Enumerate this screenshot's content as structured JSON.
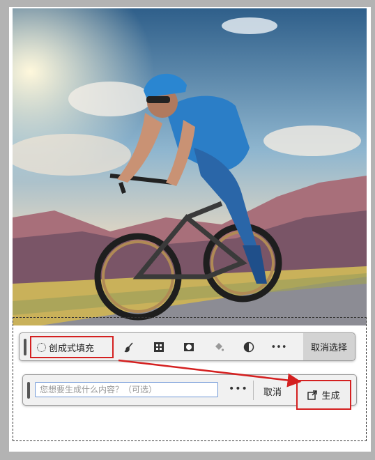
{
  "toolbar": {
    "generative_fill_label": "创成式填充",
    "deselect_label": "取消选择",
    "tool_icons": [
      "brush-icon",
      "mask-pattern-icon",
      "mask-icon",
      "paint-bucket-icon",
      "invert-icon",
      "more-icon"
    ]
  },
  "prompt_bar": {
    "placeholder": "您想要生成什么内容？（可选）",
    "value": "",
    "cancel_label": "取消",
    "generate_label": "生成"
  },
  "colors": {
    "highlight": "#d42020",
    "prompt_border": "#6d95d5"
  }
}
